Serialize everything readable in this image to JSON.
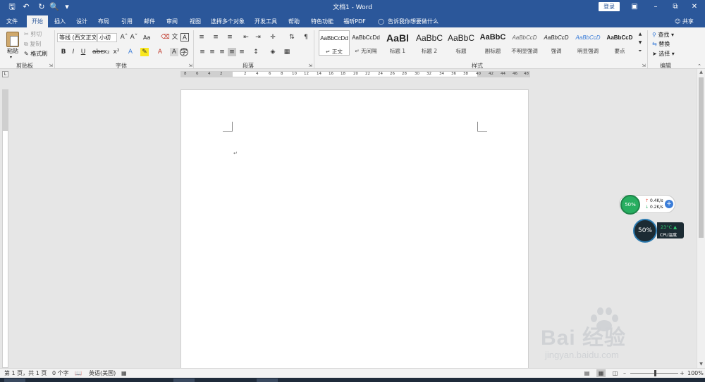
{
  "window": {
    "title": "文档1 - Word",
    "login_label": "登录",
    "quick_access": [
      "save-icon",
      "undo-icon",
      "redo-icon",
      "print-preview-icon",
      "customize-icon"
    ]
  },
  "tabs": [
    {
      "label": "文件",
      "active": false
    },
    {
      "label": "开始",
      "active": true
    },
    {
      "label": "插入",
      "active": false
    },
    {
      "label": "设计",
      "active": false
    },
    {
      "label": "布局",
      "active": false
    },
    {
      "label": "引用",
      "active": false
    },
    {
      "label": "邮件",
      "active": false
    },
    {
      "label": "审阅",
      "active": false
    },
    {
      "label": "视图",
      "active": false
    },
    {
      "label": "选择多个对象",
      "active": false
    },
    {
      "label": "开发工具",
      "active": false
    },
    {
      "label": "帮助",
      "active": false
    },
    {
      "label": "特色功能",
      "active": false
    },
    {
      "label": "福昕PDF",
      "active": false
    }
  ],
  "tell_me": "告诉我你想要做什么",
  "share_label": "共享",
  "clipboard": {
    "group_label": "剪贴板",
    "paste": "粘贴",
    "cut": "剪切",
    "copy": "复制",
    "format_painter": "格式刷"
  },
  "font": {
    "group_label": "字体",
    "font_name": "等线 (西文正文)",
    "font_size": "小初",
    "change_case": "Aa"
  },
  "paragraph": {
    "group_label": "段落"
  },
  "styles": {
    "group_label": "样式",
    "items": [
      {
        "sample": "AaBbCcDd",
        "name": "↵ 正文",
        "selected": true
      },
      {
        "sample": "AaBbCcDd",
        "name": "↵ 无间隔",
        "selected": false
      },
      {
        "sample": "AaBl",
        "name": "标题 1",
        "selected": false
      },
      {
        "sample": "AaBbC",
        "name": "标题 2",
        "selected": false
      },
      {
        "sample": "AaBbC",
        "name": "标题",
        "selected": false
      },
      {
        "sample": "AaBbC",
        "name": "副标题",
        "selected": false
      },
      {
        "sample": "AaBbCcD",
        "name": "不明显强调",
        "selected": false
      },
      {
        "sample": "AaBbCcD",
        "name": "强调",
        "selected": false
      },
      {
        "sample": "AaBbCcD",
        "name": "明显强调",
        "selected": false
      },
      {
        "sample": "AaBbCcD",
        "name": "要点",
        "selected": false
      }
    ]
  },
  "editing": {
    "group_label": "编辑",
    "find": "查找",
    "replace": "替换",
    "select": "选择"
  },
  "ruler": {
    "corner": "L",
    "left_ticks": [
      "8",
      "6",
      "4",
      "2"
    ],
    "right_ticks": [
      "2",
      "4",
      "6",
      "8",
      "10",
      "12",
      "14",
      "16",
      "18",
      "20",
      "22",
      "24",
      "26",
      "28",
      "30",
      "32",
      "34",
      "36",
      "38",
      "40",
      "42",
      "44",
      "46",
      "48"
    ]
  },
  "document": {
    "paragraph_mark": "↵"
  },
  "net_widget": {
    "percent": "50%",
    "upload": "0.4K/s",
    "download": "0.2K/s"
  },
  "cpu_widget": {
    "percent": "50%",
    "temperature": "23°C",
    "label": "CPU温度"
  },
  "watermark": {
    "brand": "Bai  经验",
    "url": "jingyan.baidu.com"
  },
  "status": {
    "page": "第 1 页，共 1 页",
    "words": "0 个字",
    "language": "英语(美国)",
    "zoom": "100%"
  },
  "colors": {
    "brand_blue": "#2b579a",
    "ribbon_bg": "#f3f3f3",
    "workspace_bg": "#e6e6e6"
  }
}
